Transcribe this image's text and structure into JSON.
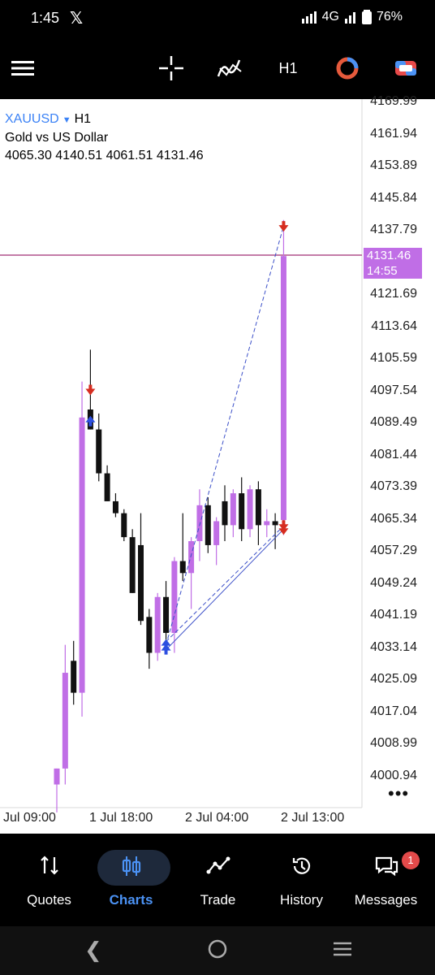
{
  "status": {
    "time": "1:45",
    "app_glyph": "𝕏",
    "network": "4G",
    "battery": "76%"
  },
  "toolbar": {
    "timeframe": "H1"
  },
  "symbol": {
    "code": "XAUUSD",
    "tf": "H1",
    "name": "Gold vs US Dollar",
    "ohlc": "4065.30 4140.51 4061.51 4131.46"
  },
  "price_axis": [
    "4169.99",
    "4161.94",
    "4153.89",
    "4145.84",
    "4137.79",
    "4121.69",
    "4113.64",
    "4105.59",
    "4097.54",
    "4089.49",
    "4081.44",
    "4073.39",
    "4065.34",
    "4057.29",
    "4049.24",
    "4041.19",
    "4033.14",
    "4025.09",
    "4017.04",
    "4008.99",
    "4000.94"
  ],
  "current_price": {
    "price": "4131.46",
    "countdown": "14:55"
  },
  "time_axis": [
    "Jul 09:00",
    "1 Jul 18:00",
    "2 Jul 04:00",
    "2 Jul 13:00"
  ],
  "candles": [
    {
      "o": 3999.0,
      "h": 4003.0,
      "l": 3992.0,
      "c": 4003.0
    },
    {
      "o": 4003.0,
      "h": 4034.0,
      "l": 3999.0,
      "c": 4027.0
    },
    {
      "o": 4030.0,
      "h": 4035.0,
      "l": 4019.0,
      "c": 4022.0
    },
    {
      "o": 4022.0,
      "h": 4100.0,
      "l": 4016.0,
      "c": 4091.0
    },
    {
      "o": 4093.0,
      "h": 4108.0,
      "l": 4088.0,
      "c": 4088.0
    },
    {
      "o": 4088.0,
      "h": 4092.0,
      "l": 4075.0,
      "c": 4077.0
    },
    {
      "o": 4077.0,
      "h": 4079.0,
      "l": 4070.0,
      "c": 4070.0
    },
    {
      "o": 4070.0,
      "h": 4072.0,
      "l": 4066.0,
      "c": 4067.0
    },
    {
      "o": 4067.0,
      "h": 4068.0,
      "l": 4060.0,
      "c": 4061.0
    },
    {
      "o": 4061.0,
      "h": 4063.0,
      "l": 4047.0,
      "c": 4047.0
    },
    {
      "o": 4059.0,
      "h": 4067.0,
      "l": 4039.0,
      "c": 4040.0
    },
    {
      "o": 4041.0,
      "h": 4043.0,
      "l": 4028.0,
      "c": 4032.0
    },
    {
      "o": 4032.0,
      "h": 4047.0,
      "l": 4030.0,
      "c": 4046.0
    },
    {
      "o": 4046.0,
      "h": 4050.0,
      "l": 4033.0,
      "c": 4037.0
    },
    {
      "o": 4037.0,
      "h": 4056.0,
      "l": 4032.0,
      "c": 4055.0
    },
    {
      "o": 4055.0,
      "h": 4067.0,
      "l": 4050.0,
      "c": 4052.0
    },
    {
      "o": 4052.0,
      "h": 4061.0,
      "l": 4043.0,
      "c": 4060.0
    },
    {
      "o": 4060.0,
      "h": 4073.0,
      "l": 4055.0,
      "c": 4069.0
    },
    {
      "o": 4069.0,
      "h": 4071.0,
      "l": 4057.0,
      "c": 4059.0
    },
    {
      "o": 4059.0,
      "h": 4066.0,
      "l": 4054.0,
      "c": 4065.0
    },
    {
      "o": 4070.0,
      "h": 4074.0,
      "l": 4060.0,
      "c": 4064.0
    },
    {
      "o": 4064.0,
      "h": 4073.0,
      "l": 4061.0,
      "c": 4072.0
    },
    {
      "o": 4072.0,
      "h": 4076.0,
      "l": 4060.0,
      "c": 4063.0
    },
    {
      "o": 4063.0,
      "h": 4074.0,
      "l": 4061.0,
      "c": 4073.0
    },
    {
      "o": 4073.0,
      "h": 4075.0,
      "l": 4059.0,
      "c": 4064.0
    },
    {
      "o": 4064.0,
      "h": 4068.0,
      "l": 4061.0,
      "c": 4065.0
    },
    {
      "o": 4065.0,
      "h": 4067.0,
      "l": 4058.0,
      "c": 4064.0
    },
    {
      "o": 4065.3,
      "h": 4140.51,
      "l": 4061.51,
      "c": 4131.46
    }
  ],
  "colors": {
    "bull": "#c06ee6",
    "bear": "#111111",
    "price_line": "#b0508c",
    "buy_arrow": "#2d4fe0",
    "sell_arrow": "#d62d20",
    "link_line": "#3b4fc8"
  },
  "nav": [
    {
      "label": "Quotes",
      "icon": "arrows-updown-icon"
    },
    {
      "label": "Charts",
      "icon": "candles-icon"
    },
    {
      "label": "Trade",
      "icon": "trend-icon"
    },
    {
      "label": "History",
      "icon": "history-icon"
    },
    {
      "label": "Messages",
      "icon": "chat-icon",
      "badge": "1"
    }
  ]
}
